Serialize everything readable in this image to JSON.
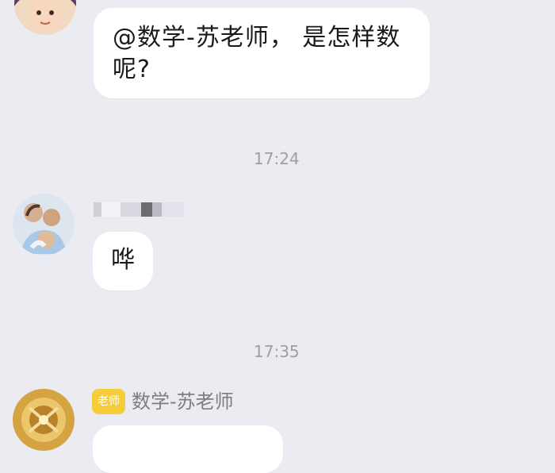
{
  "messages": [
    {
      "text": "@数学-苏老师， 是怎样数呢?",
      "line1": "@数学-苏老师， 是怎样数",
      "line2": "呢?"
    },
    {
      "text": "哗"
    },
    {
      "text": ""
    }
  ],
  "timestamps": [
    "17:24",
    "17:35"
  ],
  "sender_teacher": {
    "badge": "老师",
    "name": "数学-苏老师"
  },
  "colors": {
    "background": "#ebebf2",
    "bubble": "#ffffff",
    "badge": "#f5cd3a",
    "timestamp": "#9e9ea6"
  }
}
